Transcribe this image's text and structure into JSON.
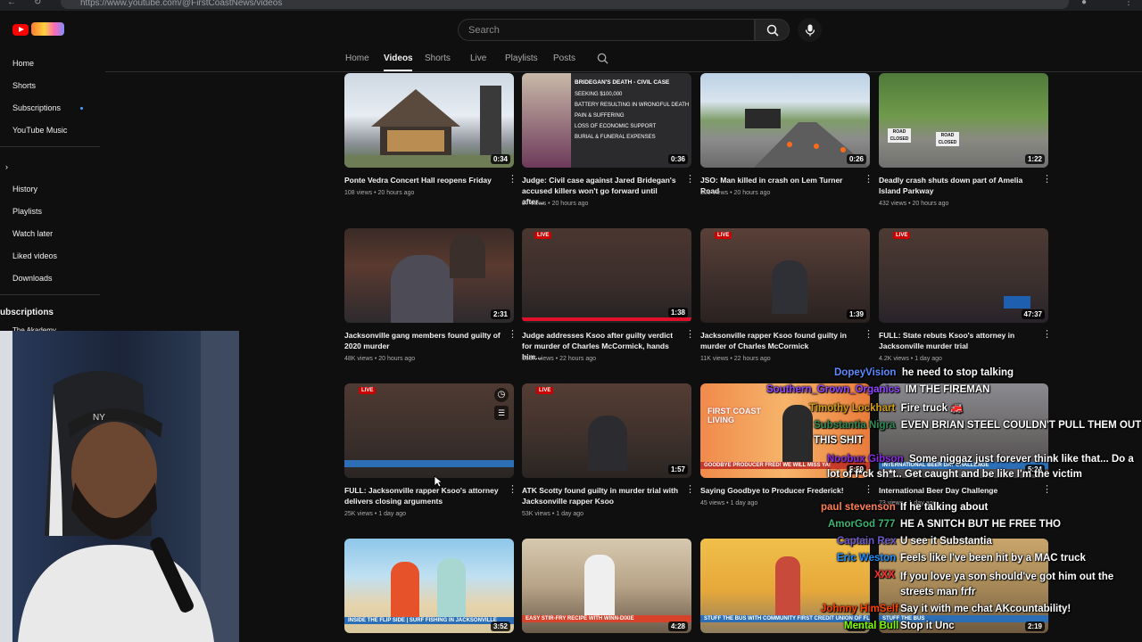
{
  "browser": {
    "url": "https://www.youtube.com/@FirstCoastNews/videos"
  },
  "search": {
    "placeholder": "Search"
  },
  "sidebar": {
    "items": [
      "Home",
      "Shorts",
      "Subscriptions",
      "YouTube Music"
    ],
    "you_items": [
      "History",
      "Playlists",
      "Watch later",
      "Liked videos",
      "Downloads"
    ],
    "subscriptions_heading": "Subscriptions",
    "subscription_first": "The Akademy"
  },
  "tabs": [
    "Home",
    "Videos",
    "Shorts",
    "Live",
    "Playlists",
    "Posts"
  ],
  "videos": [
    {
      "title": "Ponte Vedra Concert Hall reopens Friday",
      "views": "108 views",
      "age": "20 hours ago",
      "duration": "0:34",
      "live": false,
      "overlay": ""
    },
    {
      "title": "Judge: Civil case against Jared Bridegan's accused killers won't go forward until after...",
      "views": "87 views",
      "age": "20 hours ago",
      "duration": "0:36",
      "live": false,
      "overlay": ""
    },
    {
      "title": "JSO: Man killed in crash on Lem Turner Road",
      "views": "305 views",
      "age": "20 hours ago",
      "duration": "0:26",
      "live": false,
      "overlay": ""
    },
    {
      "title": "Deadly crash shuts down part of Amelia Island Parkway",
      "views": "432 views",
      "age": "20 hours ago",
      "duration": "1:22",
      "live": false,
      "overlay": ""
    },
    {
      "title": "Jacksonville gang members found guilty of 2020 murder",
      "views": "48K views",
      "age": "20 hours ago",
      "duration": "2:31",
      "live": false,
      "overlay": ""
    },
    {
      "title": "Judge addresses Ksoo after guilty verdict for murder of Charles McCormick, hands him...",
      "views": "165K views",
      "age": "22 hours ago",
      "duration": "1:38",
      "live": true,
      "overlay": ""
    },
    {
      "title": "Jacksonville rapper Ksoo found guilty in murder of Charles McCormick",
      "views": "11K views",
      "age": "22 hours ago",
      "duration": "1:39",
      "live": true,
      "overlay": ""
    },
    {
      "title": "FULL: State rebuts Ksoo's attorney in Jacksonville murder trial",
      "views": "4.2K views",
      "age": "1 day ago",
      "duration": "47:37",
      "live": true,
      "overlay": ""
    },
    {
      "title": "FULL: Jacksonville rapper Ksoo's attorney delivers closing arguments",
      "views": "25K views",
      "age": "1 day ago",
      "duration": "",
      "live": true,
      "overlay": ""
    },
    {
      "title": "ATK Scotty found guilty in murder trial with Jacksonville rapper Ksoo",
      "views": "53K views",
      "age": "1 day ago",
      "duration": "1:57",
      "live": true,
      "overlay": ""
    },
    {
      "title": "Saying Goodbye to Producer Frederick!",
      "views": "45 views",
      "age": "1 day ago",
      "duration": "5:59",
      "live": false,
      "overlay": "GOODBYE PRODUCER FRED! WE WILL MISS YA!"
    },
    {
      "title": "International Beer Day Challenge",
      "views": "73 views",
      "age": "1 day ago",
      "duration": "5:24",
      "live": false,
      "overlay": "INTERNATIONAL BEER DAY CHALLENGE"
    },
    {
      "title": "",
      "views": "",
      "age": "",
      "duration": "3:52",
      "live": false,
      "overlay": "INSIDE THE FLIP SIDE | SURF FISHING IN JACKSONVILLE"
    },
    {
      "title": "",
      "views": "",
      "age": "",
      "duration": "4:28",
      "live": false,
      "overlay": "EASY STIR-FRY RECIPE WITH WINN-DIXIE"
    },
    {
      "title": "",
      "views": "",
      "age": "",
      "duration": "3:04",
      "live": false,
      "overlay": "STUFF THE BUS WITH COMMUNITY FIRST CREDIT UNION OF FLORIDA"
    },
    {
      "title": "",
      "views": "",
      "age": "",
      "duration": "2:19",
      "live": false,
      "overlay": "STUFF THE BUS"
    }
  ],
  "thumb_texts": {
    "bridegan_heading": "BRIDEGAN'S DEATH - CIVIL CASE",
    "bridegan_lines": [
      "SEEKING $100,000",
      "BATTERY RESULTING IN WRONGFUL DEATH",
      "PAIN & SUFFERING",
      "LOSS OF ECONOMIC SUPPORT",
      "BURIAL & FUNERAL EXPENSES"
    ],
    "road_closed": "ROAD CLOSED",
    "fcl_logo": "FIRST COAST LIVING"
  },
  "chat": [
    {
      "user": "DopeyVision",
      "message": "he need to stop talking",
      "color": "#5b8cff"
    },
    {
      "user": "Southern_Grown_Organics",
      "message": "IM THE FIREMAN",
      "color": "#9146ff"
    },
    {
      "user": "Timothy Lockhart",
      "message": "Fire truck 🚒",
      "color": "#d4a017"
    },
    {
      "user": "Substantia Nigra",
      "message": "EVEN BRIAN STEEL COULDN'T PULL THEM OUT THIS SHIT",
      "color": "#2e8b57"
    },
    {
      "user": "Noobux Gibson",
      "message": "Some niggaz just forever think like that... Do a lot of f*ck sh*t.. Get caught and be like I'm the victim",
      "color": "#8a2be2"
    },
    {
      "user": "",
      "message": "If he talking about",
      "color": "#ffffff"
    },
    {
      "user": "paul stevenson",
      "message": "HE A SNITCH BUT HE FREE THO",
      "color": "#ff7f50"
    },
    {
      "user": "AmorGod 777",
      "message": "U see it Substantia",
      "color": "#3cb371"
    },
    {
      "user": "Captain Rex",
      "message": "Feels like I've been hit by a MAC truck",
      "color": "#6a5acd"
    },
    {
      "user": "Eric Weston",
      "message": "If you love ya son should've got him out the streets man frfr",
      "color": "#1e90ff"
    },
    {
      "user": "XXX",
      "message": "Say it with me chat AKcountability!",
      "color": "#ff3030"
    },
    {
      "user": "Johnny HimSelf",
      "message": "Stop it Unc",
      "color": "#ff4500"
    },
    {
      "user": "Mental Bull",
      "message": "",
      "color": "#7cfc00"
    }
  ]
}
